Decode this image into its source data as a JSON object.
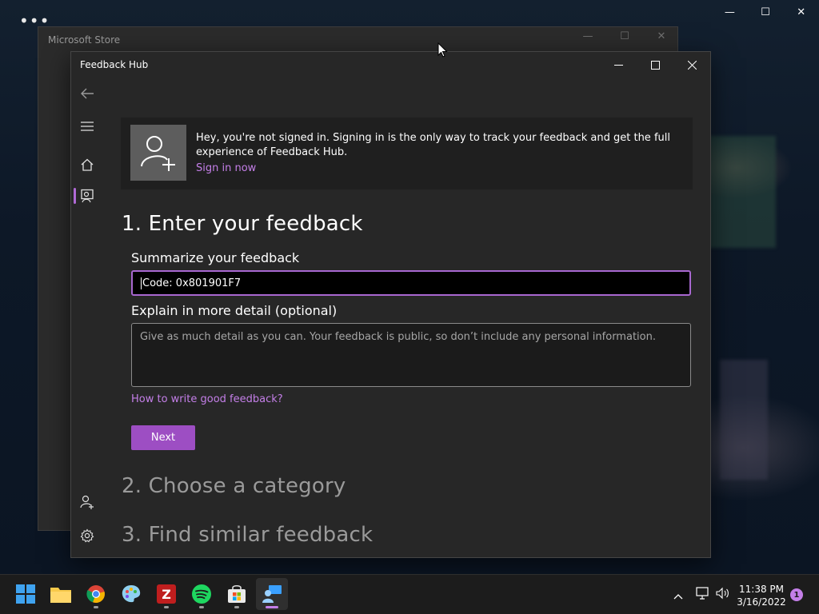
{
  "desktop": {
    "menu_dots": "•••",
    "caption_minimize": "—",
    "caption_maximize": "☐",
    "caption_close": "✕"
  },
  "ms_store": {
    "title": "Microsoft Store",
    "caption_minimize": "—",
    "caption_maximize": "☐",
    "caption_close": "✕"
  },
  "feedback_hub": {
    "title": "Feedback Hub",
    "caption_minimize": "—",
    "caption_maximize": "☐",
    "caption_close": "✕",
    "nav": {
      "back_icon": "arrow-left-icon",
      "menu_icon": "hamburger-icon",
      "home_icon": "home-icon",
      "feedback_icon": "feedback-person-icon",
      "account_icon": "add-person-icon",
      "settings_icon": "gear-icon",
      "accent": "#b06ad6"
    },
    "banner": {
      "message": "Hey, you're not signed in. Signing in is the only way to track your feedback and get the full experience of Feedback Hub.",
      "link": "Sign in now"
    },
    "step1": {
      "heading": "1. Enter your feedback",
      "summary_label": "Summarize your feedback",
      "summary_value": "Code: 0x801901F7",
      "detail_label": "Explain in more detail (optional)",
      "detail_placeholder": "Give as much detail as you can. Your feedback is public, so don’t include any personal information.",
      "help_link": "How to write good feedback?",
      "next_label": "Next"
    },
    "step2": {
      "heading": "2. Choose a category"
    },
    "step3": {
      "heading": "3. Find similar feedback"
    }
  },
  "taskbar": {
    "apps": [
      {
        "name": "start",
        "icon": "windows-logo-icon"
      },
      {
        "name": "file-explorer",
        "icon": "folder-icon"
      },
      {
        "name": "chrome",
        "icon": "chrome-icon"
      },
      {
        "name": "paint",
        "icon": "paint-palette-icon"
      },
      {
        "name": "filezilla",
        "icon": "filezilla-icon"
      },
      {
        "name": "spotify",
        "icon": "spotify-icon"
      },
      {
        "name": "microsoft-store",
        "icon": "store-bag-icon"
      },
      {
        "name": "feedback-hub",
        "icon": "feedback-hub-icon"
      }
    ],
    "time": "11:38 PM",
    "date": "3/16/2022",
    "notification_count": "1"
  }
}
